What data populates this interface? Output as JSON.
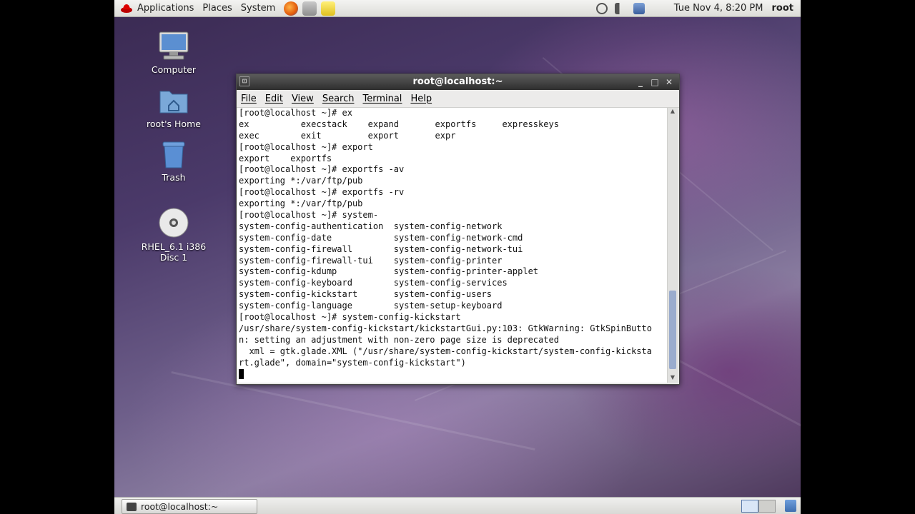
{
  "top_panel": {
    "applications": "Applications",
    "places": "Places",
    "system": "System",
    "clock": "Tue Nov  4,  8:20 PM",
    "user": "root",
    "launchers": [
      "firefox-icon",
      "mail-icon",
      "notes-icon"
    ],
    "tray": [
      "update-icon",
      "volume-icon",
      "network-icon"
    ]
  },
  "desktop": {
    "icons": [
      {
        "label": "Computer",
        "icon": "computer-icon"
      },
      {
        "label": "root's Home",
        "icon": "folder-home-icon"
      },
      {
        "label": "Trash",
        "icon": "trash-icon"
      },
      {
        "label": "RHEL_6.1 i386 Disc 1",
        "icon": "disc-icon"
      }
    ]
  },
  "terminal": {
    "title": "root@localhost:~",
    "menu": [
      "File",
      "Edit",
      "View",
      "Search",
      "Terminal",
      "Help"
    ],
    "lines": [
      "[root@localhost ~]# ex",
      "ex          execstack    expand       exportfs     expresskeys",
      "exec        exit         export       expr",
      "[root@localhost ~]# export",
      "export    exportfs",
      "[root@localhost ~]# exportfs -av",
      "exporting *:/var/ftp/pub",
      "[root@localhost ~]# exportfs -rv",
      "exporting *:/var/ftp/pub",
      "[root@localhost ~]# system-",
      "system-config-authentication  system-config-network",
      "system-config-date            system-config-network-cmd",
      "system-config-firewall        system-config-network-tui",
      "system-config-firewall-tui    system-config-printer",
      "system-config-kdump           system-config-printer-applet",
      "system-config-keyboard        system-config-services",
      "system-config-kickstart       system-config-users",
      "system-config-language        system-setup-keyboard",
      "[root@localhost ~]# system-config-kickstart",
      "/usr/share/system-config-kickstart/kickstartGui.py:103: GtkWarning: GtkSpinButto",
      "n: setting an adjustment with non-zero page size is deprecated",
      "  xml = gtk.glade.XML (\"/usr/share/system-config-kickstart/system-config-kicksta",
      "rt.glade\", domain=\"system-config-kickstart\")"
    ]
  },
  "taskbar": {
    "task": "root@localhost:~"
  }
}
